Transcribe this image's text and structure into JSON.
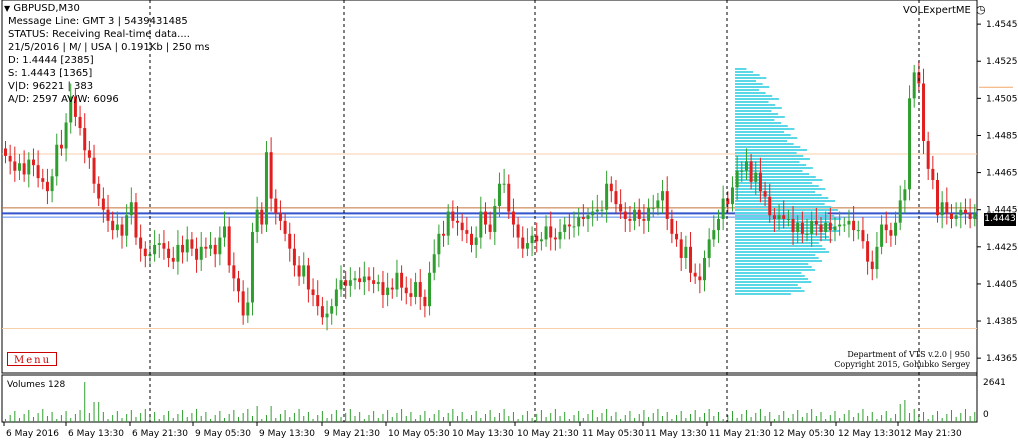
{
  "window": {
    "title": "GBPUSD,M30",
    "indicator_name": "VOLExpertME",
    "alert_icon": "alarm-clock-icon"
  },
  "info_panel": {
    "lines": [
      "Message Line: GMT 3 | 5439431485",
      "STATUS:  Receiving Real-time data....",
      "21/5/2016 | M/ | USA | 0.191Kb | 250 ms",
      "D: 1.4444  [2385]",
      "S: 1.4443  [1365]",
      "V|D: 96221 | 383",
      "A/D: 2597 AV/W: 6096"
    ]
  },
  "menu_button": {
    "label": "Menu"
  },
  "credits": {
    "line1": "Department of VTS  v.2.0 | 950",
    "line2": "Copyright 2015, Gohubko Sergey"
  },
  "price_axis": {
    "labels": [
      "1.4545",
      "1.4525",
      "1.4505",
      "1.4485",
      "1.4465",
      "1.4445",
      "1.4425",
      "1.4405",
      "1.4385",
      "1.4365"
    ],
    "current_price": "1.4443"
  },
  "volume_panel": {
    "title": "Volumes 128",
    "axis_top": "2641",
    "axis_bottom": "0"
  },
  "time_axis": {
    "labels": [
      "6 May 2016",
      "6 May 13:30",
      "6 May 21:30",
      "9 May 05:30",
      "9 May 13:30",
      "9 May 21:30",
      "10 May 05:30",
      "10 May 13:30",
      "10 May 21:30",
      "11 May 05:30",
      "11 May 13:30",
      "11 May 21:30",
      "12 May 05:30",
      "12 May 13:30",
      "12 May 21:30"
    ]
  },
  "colors": {
    "bull": "#2e9e2e",
    "bear": "#e02020",
    "profile": "#5ad8e8",
    "price_line_blue": "#3355cc",
    "level_orange": "#f3a86a"
  },
  "chart_data": {
    "type": "candlestick",
    "symbol": "GBPUSD",
    "timeframe": "M30",
    "ylim": [
      1.4357,
      1.4558
    ],
    "levels": [
      1.4475,
      1.4446,
      1.4443,
      1.4441,
      1.4381
    ],
    "closes": [
      1.4474,
      1.4471,
      1.4466,
      1.447,
      1.4464,
      1.4472,
      1.4469,
      1.4462,
      1.446,
      1.4455,
      1.4463,
      1.448,
      1.4478,
      1.4492,
      1.4506,
      1.4495,
      1.4489,
      1.4477,
      1.4473,
      1.4459,
      1.4451,
      1.4445,
      1.4439,
      1.4434,
      1.4437,
      1.4431,
      1.4442,
      1.4449,
      1.443,
      1.4424,
      1.442,
      1.4421,
      1.4426,
      1.4427,
      1.4424,
      1.4419,
      1.4417,
      1.4426,
      1.4422,
      1.4429,
      1.4424,
      1.4418,
      1.4425,
      1.4424,
      1.4426,
      1.4421,
      1.443,
      1.4436,
      1.4415,
      1.4408,
      1.4401,
      1.4388,
      1.4395,
      1.4433,
      1.4445,
      1.4437,
      1.4476,
      1.4451,
      1.4443,
      1.4439,
      1.4432,
      1.4424,
      1.4415,
      1.4409,
      1.4415,
      1.4402,
      1.4399,
      1.4393,
      1.4387,
      1.4389,
      1.4393,
      1.4402,
      1.4407,
      1.4404,
      1.4407,
      1.4408,
      1.4406,
      1.4409,
      1.4407,
      1.4405,
      1.4406,
      1.4399,
      1.4403,
      1.4402,
      1.4411,
      1.4403,
      1.44,
      1.4398,
      1.4406,
      1.4398,
      1.4393,
      1.4411,
      1.4421,
      1.4432,
      1.4431,
      1.4444,
      1.4439,
      1.4438,
      1.4434,
      1.4432,
      1.4426,
      1.443,
      1.4444,
      1.4437,
      1.4433,
      1.4447,
      1.4459,
      1.4459,
      1.4444,
      1.4437,
      1.443,
      1.4424,
      1.4427,
      1.4431,
      1.4428,
      1.4429,
      1.4436,
      1.443,
      1.4429,
      1.4433,
      1.4437,
      1.4436,
      1.4436,
      1.4441,
      1.444,
      1.4442,
      1.4444,
      1.4445,
      1.4445,
      1.4459,
      1.4455,
      1.4448,
      1.4444,
      1.444,
      1.4439,
      1.4445,
      1.444,
      1.4439,
      1.4446,
      1.4446,
      1.445,
      1.4455,
      1.444,
      1.4432,
      1.4429,
      1.4419,
      1.4425,
      1.4411,
      1.4409,
      1.4407,
      1.4419,
      1.4429,
      1.4434,
      1.444,
      1.4451,
      1.4448,
      1.4457,
      1.4466,
      1.4466,
      1.4471,
      1.446,
      1.4465,
      1.4455,
      1.4452,
      1.4442,
      1.444,
      1.4442,
      1.444,
      1.444,
      1.4433,
      1.4438,
      1.4432,
      1.4432,
      1.4439,
      1.4437,
      1.4433,
      1.4438,
      1.4434,
      1.4436,
      1.4437,
      1.4437,
      1.4439,
      1.4434,
      1.4434,
      1.4428,
      1.4417,
      1.4413,
      1.4425,
      1.4437,
      1.4434,
      1.4431,
      1.4438,
      1.445,
      1.4456,
      1.4505,
      1.4519,
      1.4513,
      1.4482,
      1.4467,
      1.4461,
      1.4442,
      1.4449,
      1.4443,
      1.444,
      1.4442,
      1.4445,
      1.4443,
      1.444,
      1.4443
    ]
  }
}
